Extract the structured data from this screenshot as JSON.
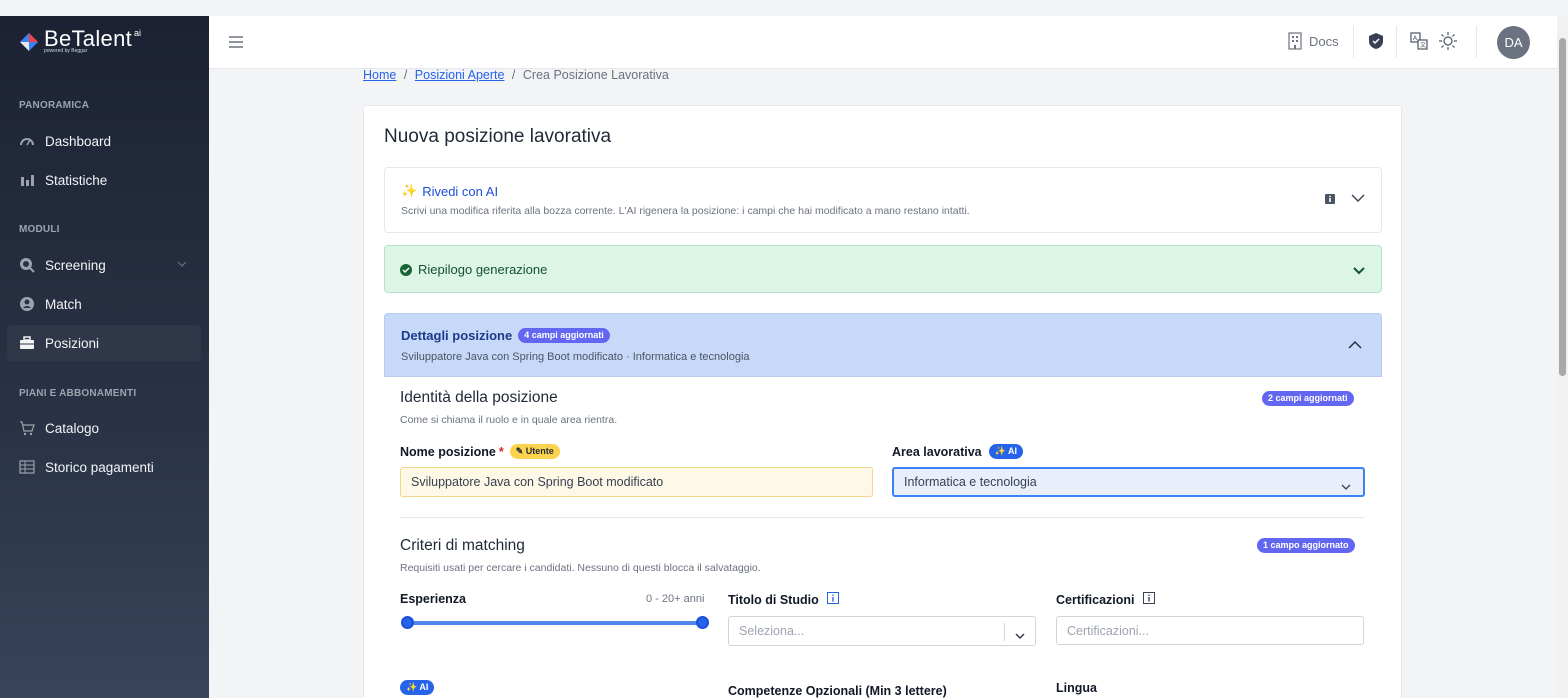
{
  "brand": {
    "name": "BeTalent",
    "superscript": "ai",
    "tagline": "powered by Beggar"
  },
  "sidebar": {
    "sections": [
      {
        "label": "PANORAMICA"
      },
      {
        "label": "MODULI"
      },
      {
        "label": "PIANI E ABBONAMENTI"
      }
    ],
    "items": [
      {
        "label": "Dashboard",
        "icon": "gauge-icon"
      },
      {
        "label": "Statistiche",
        "icon": "bar-chart-icon"
      },
      {
        "label": "Screening",
        "icon": "search-doc-icon"
      },
      {
        "label": "Match",
        "icon": "user-badge-icon"
      },
      {
        "label": "Posizioni",
        "icon": "briefcase-icon",
        "active": true
      },
      {
        "label": "Catalogo",
        "icon": "cart-icon"
      },
      {
        "label": "Storico pagamenti",
        "icon": "table-icon"
      }
    ]
  },
  "header": {
    "docs_label": "Docs",
    "avatar_initials": "DA"
  },
  "breadcrumb": {
    "home": "Home",
    "open_positions": "Posizioni Aperte",
    "current": "Crea Posizione Lavorativa",
    "separator": "/"
  },
  "page": {
    "title": "Nuova posizione lavorativa",
    "ai_review": {
      "title": "Rivedi con AI",
      "description": "Scrivi una modifica riferita alla bozza corrente. L'AI rigenera la posizione: i campi che hai modificato a mano restano intatti."
    },
    "summary": {
      "label": "Riepilogo generazione"
    },
    "details": {
      "title": "Dettagli posizione",
      "badge": "4 campi aggiornati",
      "subtitle": "Sviluppatore Java con Spring Boot modificato · Informatica e tecnologia"
    },
    "identity": {
      "title": "Identità della posizione",
      "description": "Come si chiama il ruolo e in quale area rientra.",
      "badge": "2 campi aggiornati",
      "name_label": "Nome posizione",
      "name_required": "*",
      "name_badge": "✎ Utente",
      "name_value": "Sviluppatore Java con Spring Boot modificato",
      "area_label": "Area lavorativa",
      "area_badge": "✨ AI",
      "area_value": "Informatica e tecnologia"
    },
    "matching": {
      "title": "Criteri di matching",
      "description": "Requisiti usati per cercare i candidati. Nessuno di questi blocca il salvataggio.",
      "badge": "1 campo aggiornato",
      "experience_label": "Esperienza",
      "experience_range": "0 - 20+ anni",
      "experience_min_fraction": 0,
      "experience_max_fraction": 1,
      "degree_label": "Titolo di Studio",
      "degree_placeholder": "Seleziona...",
      "cert_label": "Certificazioni",
      "cert_placeholder": "Certificazioni...",
      "ai_badge": "✨ AI",
      "optional_skills_label": "Competenze Opzionali (Min 3 lettere)",
      "language_label": "Lingua"
    }
  },
  "colors": {
    "accent": "#2563eb",
    "badge_purple": "#6366f1",
    "sidebar_bg": "#1c2233",
    "summary_bg": "#dcf5e6",
    "details_bg": "#c7d9f8"
  }
}
